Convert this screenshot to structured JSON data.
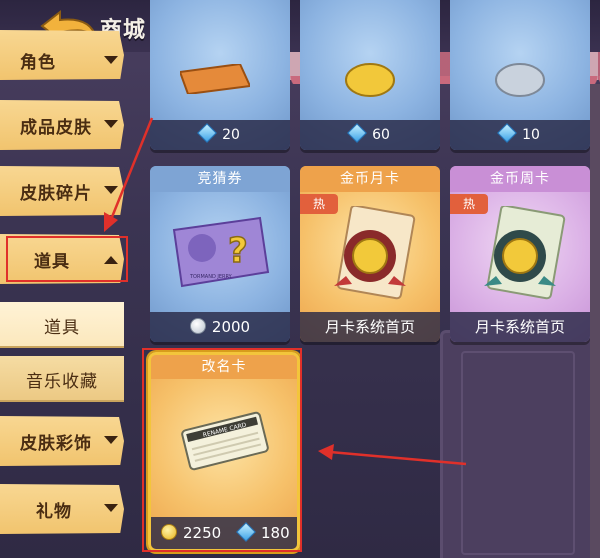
{
  "header": {
    "title": "商城"
  },
  "sidebar": {
    "items": [
      {
        "label": "角色"
      },
      {
        "label": "成品皮肤"
      },
      {
        "label": "皮肤碎片"
      },
      {
        "label": "道具"
      },
      {
        "label": "皮肤彩饰"
      },
      {
        "label": "礼物"
      }
    ],
    "subitems": [
      {
        "label": "道具"
      },
      {
        "label": "音乐收藏"
      }
    ]
  },
  "cards": {
    "row1": [
      {
        "price": "20",
        "currency": "gem"
      },
      {
        "price": "60",
        "currency": "gem"
      },
      {
        "price": "10",
        "currency": "gem"
      }
    ],
    "row2": [
      {
        "title": "竞猜券",
        "price": "2000",
        "currency": "silver-coin"
      },
      {
        "title": "金币月卡",
        "badge": "热",
        "footer": "月卡系统首页"
      },
      {
        "title": "金币周卡",
        "badge": "热",
        "footer": "月卡系统首页"
      }
    ],
    "featured": {
      "title": "改名卡",
      "coin_price": "2250",
      "gem_price": "180",
      "item_text": "RENAME CARD"
    }
  },
  "ticket_text": "TORMAND JERRY",
  "colors": {
    "highlight": "#e0302a",
    "gem": "#3fa4e8",
    "coin": "#e7b520"
  }
}
